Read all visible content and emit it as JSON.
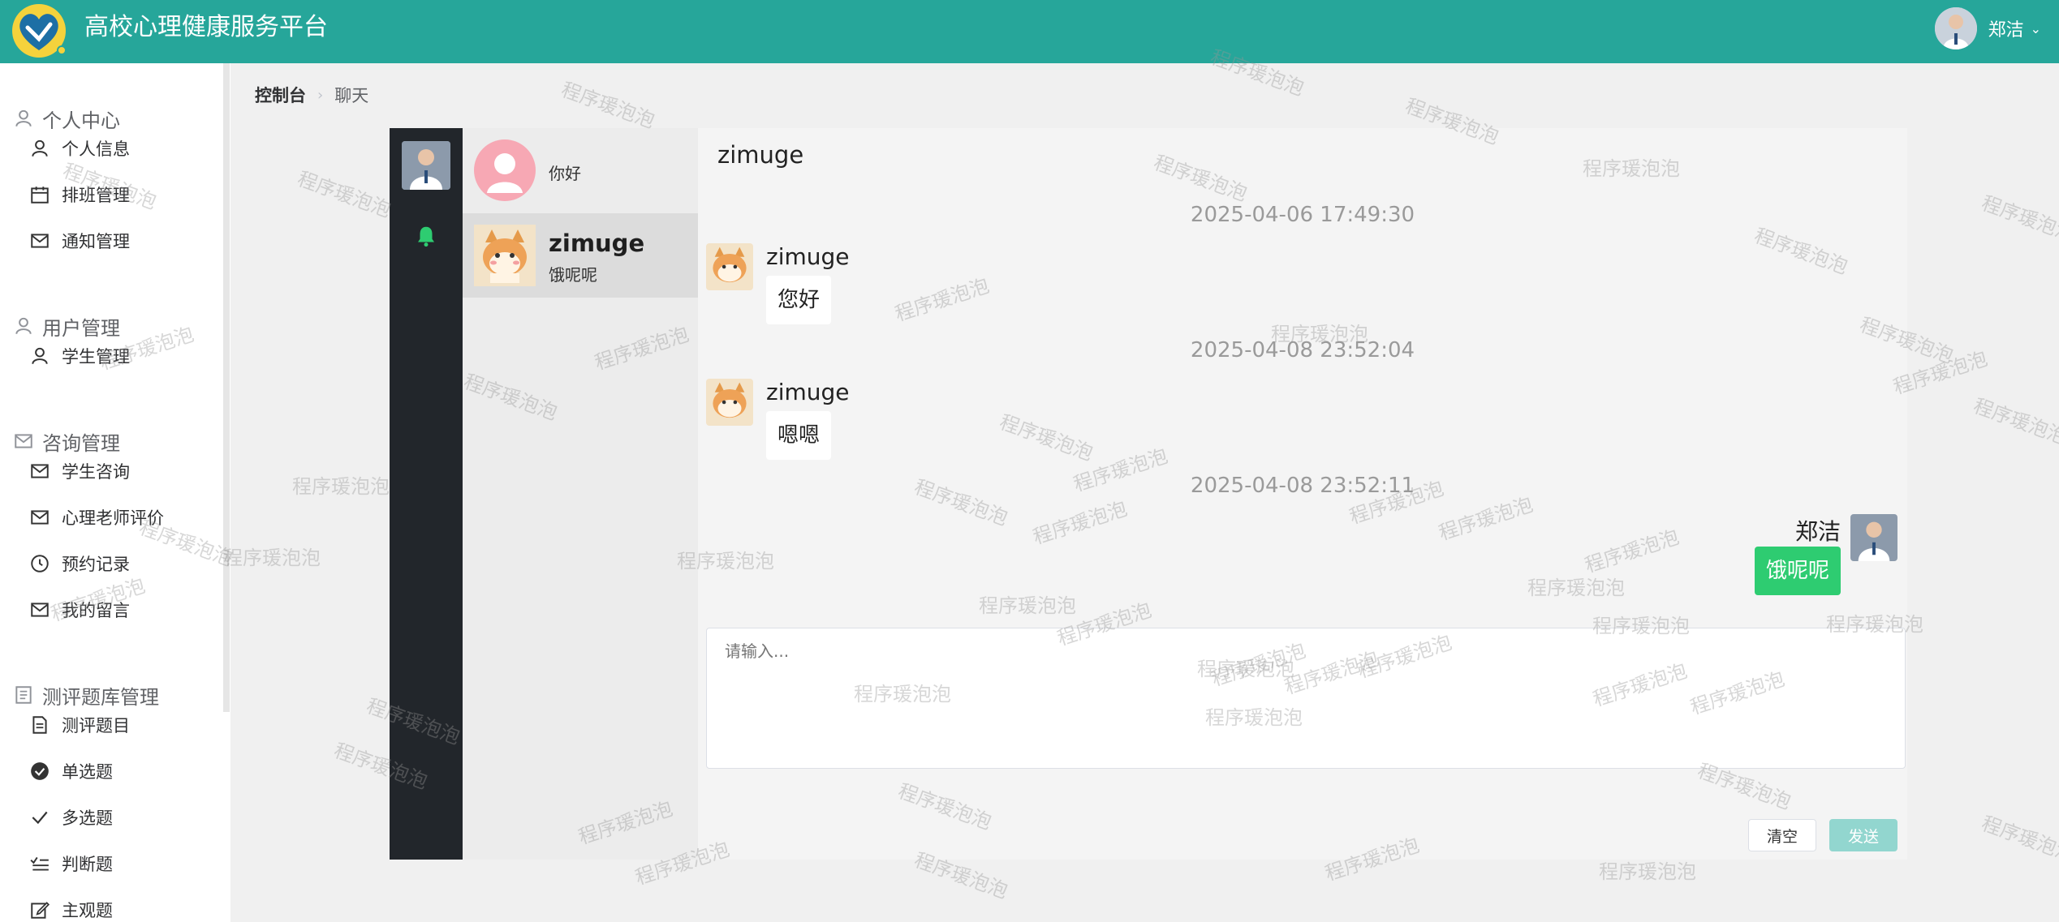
{
  "header": {
    "title": "高校心理健康服务平台",
    "user_name": "郑洁",
    "bg_color": "#26a69a"
  },
  "sidebar": {
    "groups": [
      {
        "title": "个人中心",
        "icon": "user-icon",
        "items": [
          {
            "label": "个人信息",
            "icon": "user-icon"
          },
          {
            "label": "排班管理",
            "icon": "calendar-icon"
          },
          {
            "label": "通知管理",
            "icon": "mail-icon"
          }
        ]
      },
      {
        "title": "用户管理",
        "icon": "user-icon",
        "items": [
          {
            "label": "学生管理",
            "icon": "user-icon"
          }
        ]
      },
      {
        "title": "咨询管理",
        "icon": "mail-icon",
        "items": [
          {
            "label": "学生咨询",
            "icon": "mail-icon"
          },
          {
            "label": "心理老师评价",
            "icon": "mail-icon"
          },
          {
            "label": "预约记录",
            "icon": "clock-icon"
          },
          {
            "label": "我的留言",
            "icon": "mail-icon"
          }
        ]
      },
      {
        "title": "测评题库管理",
        "icon": "document-icon",
        "items": [
          {
            "label": "测评题目",
            "icon": "document-icon"
          },
          {
            "label": "单选题",
            "icon": "check-circle-icon"
          },
          {
            "label": "多选题",
            "icon": "check-icon"
          },
          {
            "label": "判断题",
            "icon": "list-check-icon"
          },
          {
            "label": "主观题",
            "icon": "edit-icon"
          }
        ]
      }
    ]
  },
  "breadcrumb": {
    "root": "控制台",
    "current": "聊天"
  },
  "chat": {
    "nav": {
      "bell_color": "#2ecc71"
    },
    "conversations": [
      {
        "name": "",
        "last_message": "你好",
        "avatar": "pink-default-avatar"
      },
      {
        "name": "zimuge",
        "last_message": "饿呢呢",
        "avatar": "shiba-avatar",
        "active": true
      }
    ],
    "title": "zimuge",
    "messages": [
      {
        "timestamp": "2025-04-06 17:49:30",
        "sender": "zimuge",
        "text": "您好",
        "mine": false
      },
      {
        "timestamp": "2025-04-08 23:52:04",
        "sender": "zimuge",
        "text": "嗯嗯",
        "mine": false
      },
      {
        "timestamp": "2025-04-08 23:52:11",
        "sender": "郑洁",
        "text": "饿呢呢",
        "mine": true
      }
    ],
    "input_placeholder": "请输入...",
    "clear_label": "清空",
    "send_label": "发送",
    "mine_bubble_color": "#2ecc71"
  },
  "watermark": {
    "text": "程序瑗泡泡"
  }
}
